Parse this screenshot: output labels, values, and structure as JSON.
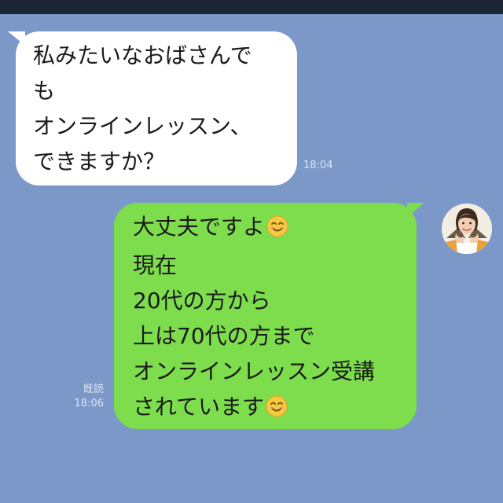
{
  "conversation": {
    "incoming": {
      "lines": [
        "私みたいなおばさんで",
        "も",
        "オンラインレッスン、",
        "できますか？"
      ],
      "time": "18:04"
    },
    "outgoing": {
      "lines": [
        "大丈夫ですよ",
        "現在",
        "20代の方から",
        "上は70代の方まで",
        "オンラインレッスン受講",
        "されています"
      ],
      "emoji_after_lines": [
        0,
        5
      ],
      "emoji_icon": "smiling-face-icon",
      "read_label": "既読",
      "time": "18:06"
    }
  },
  "colors": {
    "background": "#7b98c9",
    "top_bar": "#1b2536",
    "incoming_bubble": "#ffffff",
    "outgoing_bubble": "#7ddd4c",
    "meta_text": "#dde6f3"
  }
}
